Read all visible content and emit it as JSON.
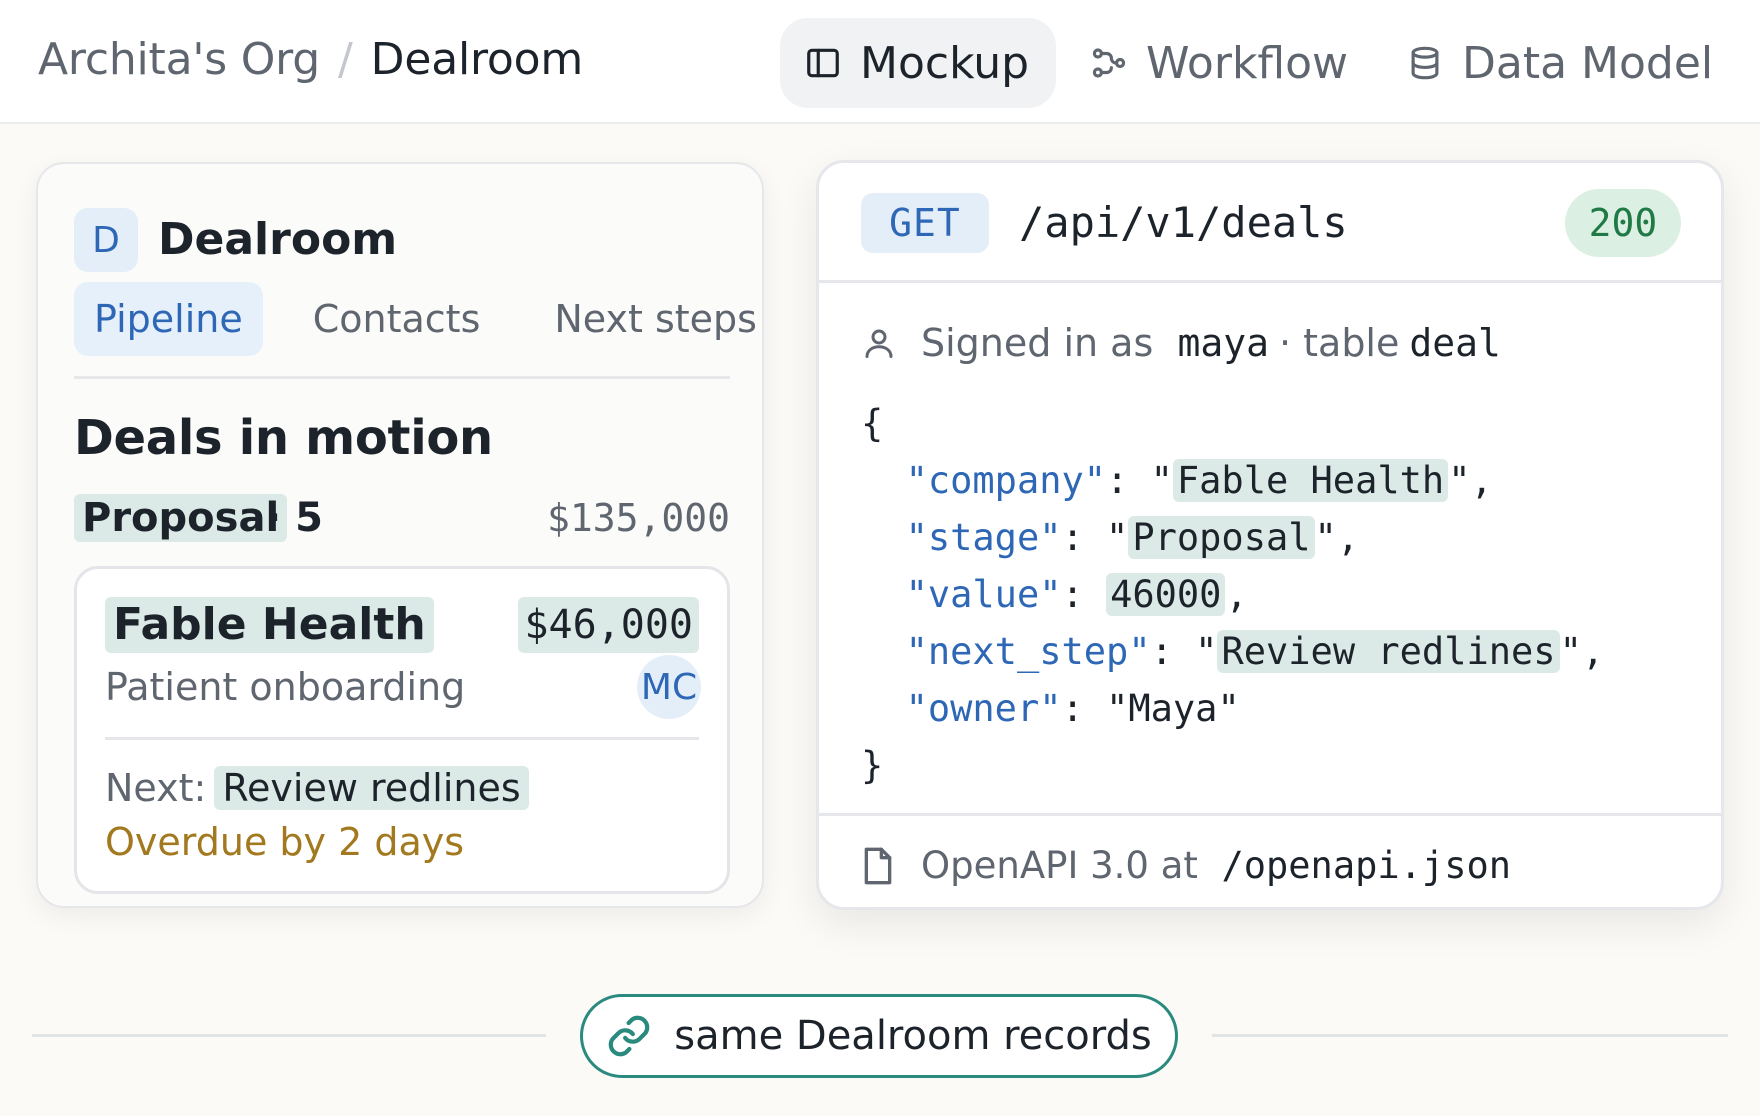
{
  "breadcrumb": {
    "org": "Archita's Org",
    "separator": "/",
    "current": "Dealroom"
  },
  "view_tabs": [
    {
      "label": "Mockup",
      "icon": "sidebar-layout-icon",
      "active": true
    },
    {
      "label": "Workflow",
      "icon": "workflow-icon",
      "active": false
    },
    {
      "label": "Data Model",
      "icon": "database-icon",
      "active": false
    }
  ],
  "mockup": {
    "app_initial": "D",
    "app_name": "Dealroom",
    "tabs": [
      {
        "label": "Pipeline",
        "active": true
      },
      {
        "label": "Contacts",
        "active": false
      },
      {
        "label": "Next steps",
        "active": false
      }
    ],
    "section_title": "Deals in motion",
    "stage": {
      "name": "Proposal",
      "count": "· 5",
      "total": "$135,000"
    },
    "deal": {
      "company": "Fable Health",
      "value": "$46,000",
      "description": "Patient onboarding",
      "owner_initials": "MC",
      "next_label": "Next:",
      "next_step": "Review redlines",
      "overdue": "Overdue by 2 days"
    }
  },
  "api": {
    "method": "GET",
    "path": "/api/v1/deals",
    "status": "200",
    "signed_in_label": "Signed in as",
    "user": "maya",
    "table_label": "· table",
    "table": "deal",
    "json": {
      "open": "{",
      "close": "}",
      "company_key": "\"company\"",
      "company_val": "Fable Health",
      "stage_key": "\"stage\"",
      "stage_val": "Proposal",
      "value_key": "\"value\"",
      "value_val": "46000",
      "next_key": "\"next_step\"",
      "next_val": "Review redlines",
      "owner_key": "\"owner\"",
      "owner_val": "\"Maya\""
    },
    "footer_label": "OpenAPI 3.0 at",
    "footer_path": "/openapi.json"
  },
  "connector": {
    "label": "same Dealroom records",
    "icon": "link-icon"
  },
  "colors": {
    "accent_blue": "#2e67b6",
    "highlight_teal": "#dbeae6",
    "status_green": "#1f7a45",
    "warning_amber": "#a3791f",
    "connector_border": "#2a8a7e"
  }
}
